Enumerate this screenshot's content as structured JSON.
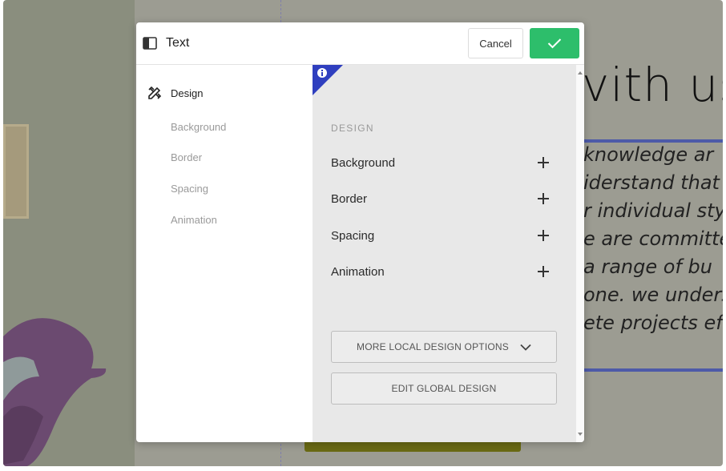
{
  "modal": {
    "title": "Text",
    "cancel_label": "Cancel",
    "confirm_icon": "checkmark-icon",
    "accent_color": "#2dbe6b"
  },
  "sidebar": {
    "main": {
      "icon": "design-tools-icon",
      "label": "Design"
    },
    "items": [
      "Background",
      "Border",
      "Spacing",
      "Animation"
    ]
  },
  "content": {
    "info_icon": "info-icon",
    "info_color": "#2f3fbf",
    "section_label": "DESIGN",
    "rows": [
      "Background",
      "Border",
      "Spacing",
      "Animation"
    ],
    "more_options_label": "MORE LOCAL DESIGN OPTIONS",
    "edit_global_label": "EDIT GLOBAL DESIGN"
  },
  "background_page": {
    "heading": "vith us",
    "lines": [
      "knowledge ar",
      "iderstand that",
      "r individual sty",
      "e are committe",
      "a range of bu",
      "one. we unders",
      "ete projects eff"
    ]
  }
}
